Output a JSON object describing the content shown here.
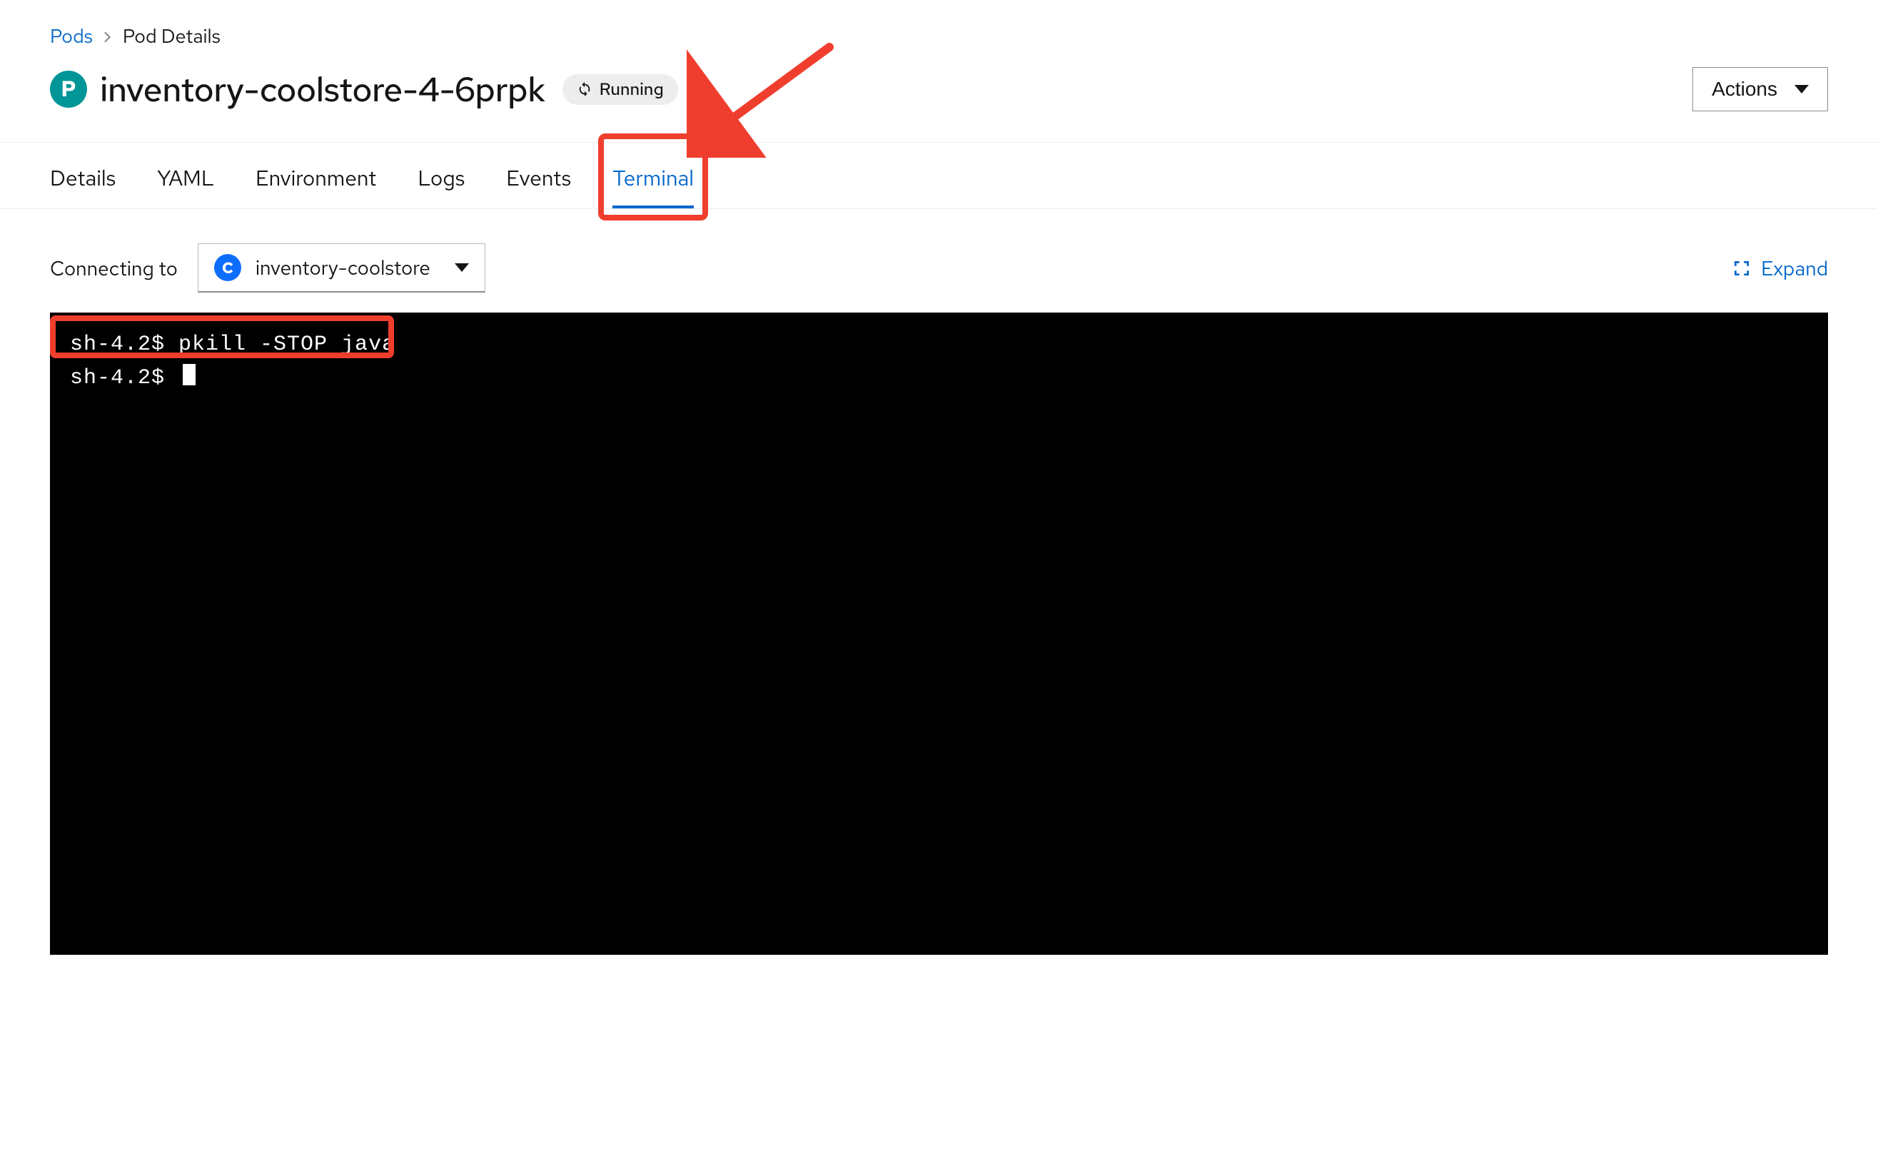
{
  "breadcrumb": {
    "parent": "Pods",
    "current": "Pod Details"
  },
  "resource_letter": "P",
  "title": "inventory-coolstore-4-6prpk",
  "status": {
    "label": "Running"
  },
  "actions_label": "Actions",
  "tabs": [
    "Details",
    "YAML",
    "Environment",
    "Logs",
    "Events",
    "Terminal"
  ],
  "active_tab": "Terminal",
  "connecting": {
    "label": "Connecting to",
    "container_letter": "C",
    "container_name": "inventory-coolstore"
  },
  "expand_label": "Expand",
  "terminal_lines": {
    "l0": "sh-4.2$ pkill -STOP java",
    "l1": "sh-4.2$ "
  }
}
